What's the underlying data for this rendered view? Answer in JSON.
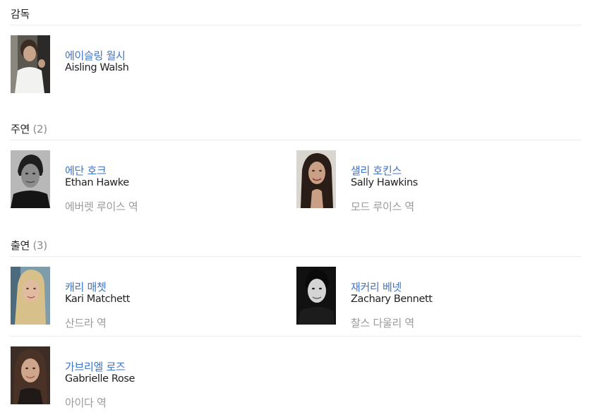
{
  "sections": {
    "director": {
      "title": "감독",
      "count": ""
    },
    "lead": {
      "title": "주연",
      "count": "(2)"
    },
    "supporting": {
      "title": "출연",
      "count": "(3)"
    }
  },
  "people": {
    "director_0": {
      "name_ko": "에이슬링 월시",
      "name_en": "Aisling Walsh",
      "role": ""
    },
    "lead_0": {
      "name_ko": "에단 호크",
      "name_en": "Ethan Hawke",
      "role": "에버렛 루이스 역"
    },
    "lead_1": {
      "name_ko": "샐리 호킨스",
      "name_en": "Sally Hawkins",
      "role": "모드 루이스 역"
    },
    "supporting_0": {
      "name_ko": "캐리 매쳇",
      "name_en": "Kari Matchett",
      "role": "산드라 역"
    },
    "supporting_1": {
      "name_ko": "재커리 베넷",
      "name_en": "Zachary Bennett",
      "role": "찰스 다울리 역"
    },
    "supporting_2": {
      "name_ko": "가브리엘 로즈",
      "name_en": "Gabrielle Rose",
      "role": "아이다 역"
    }
  },
  "colors": {
    "link": "#3d74c7",
    "muted": "#9a9a9a",
    "divider": "#ececec"
  }
}
